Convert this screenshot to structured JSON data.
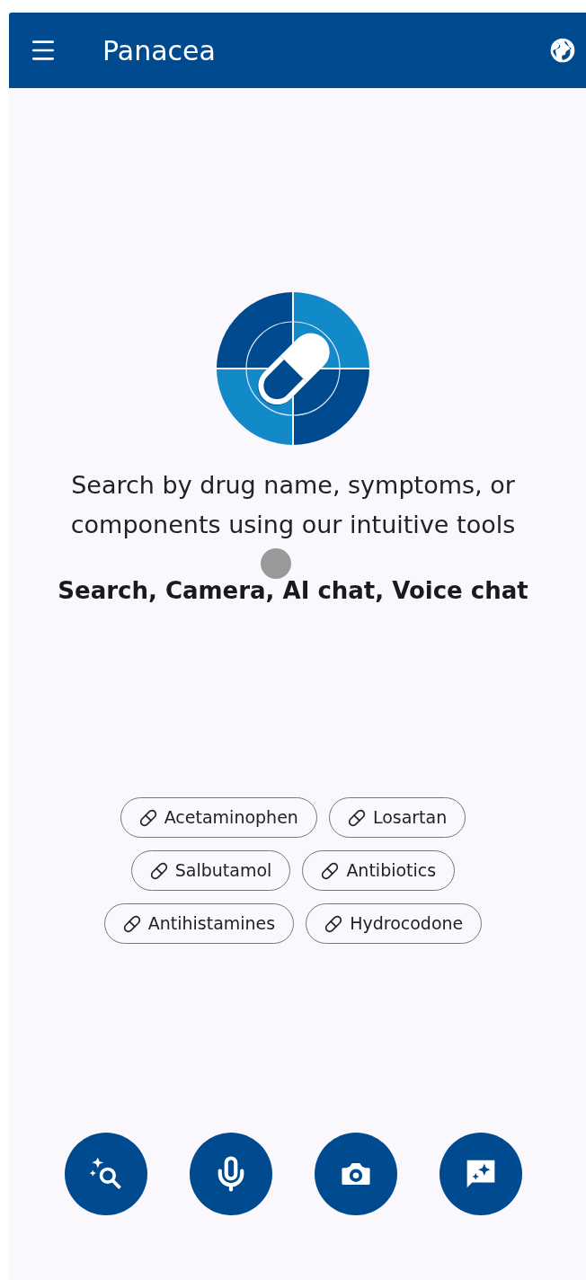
{
  "app_bar": {
    "title": "Panacea"
  },
  "intro": {
    "description": "Search by drug name, symptoms, or components using our intuitive tools",
    "tools": "Search, Camera, AI chat, Voice chat"
  },
  "suggestions": [
    {
      "label": "Acetaminophen"
    },
    {
      "label": "Losartan"
    },
    {
      "label": "Salbutamol"
    },
    {
      "label": "Antibiotics"
    },
    {
      "label": "Antihistamines"
    },
    {
      "label": "Hydrocodone"
    }
  ],
  "actions": [
    {
      "kind": "search"
    },
    {
      "kind": "voice"
    },
    {
      "kind": "camera"
    },
    {
      "kind": "chat"
    }
  ]
}
